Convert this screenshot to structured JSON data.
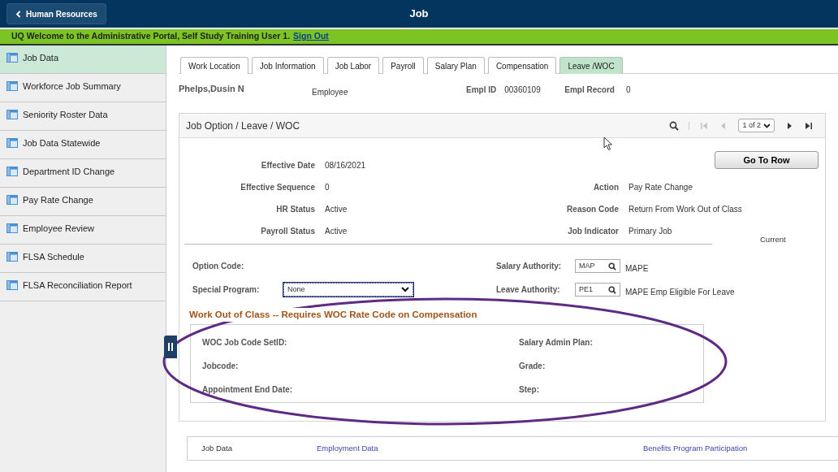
{
  "header": {
    "back_button": "Human Resources",
    "title": "Job"
  },
  "banner": {
    "text": "UQ Welcome to the Administrative Portal, Self Study Training User 1.",
    "link": "Sign Out"
  },
  "sidebar": {
    "items": [
      {
        "label": "Job Data",
        "selected": true
      },
      {
        "label": "Workforce Job Summary",
        "selected": false
      },
      {
        "label": "Seniority Roster Data",
        "selected": false
      },
      {
        "label": "Job Data Statewide",
        "selected": false
      },
      {
        "label": "Department ID Change",
        "selected": false
      },
      {
        "label": "Pay Rate Change",
        "selected": false
      },
      {
        "label": "Employee Review",
        "selected": false
      },
      {
        "label": "FLSA Schedule",
        "selected": false
      },
      {
        "label": "FLSA Reconciliation Report",
        "selected": false
      }
    ]
  },
  "tabs": [
    {
      "label": "Work Location",
      "selected": false
    },
    {
      "label": "Job Information",
      "selected": false
    },
    {
      "label": "Job Labor",
      "selected": false
    },
    {
      "label": "Payroll",
      "selected": false
    },
    {
      "label": "Salary Plan",
      "selected": false
    },
    {
      "label": "Compensation",
      "selected": false
    },
    {
      "label": "Leave /WOC",
      "selected": true
    }
  ],
  "employee": {
    "name": "Phelps,Dusin N",
    "type": "Employee",
    "empl_id_label": "Empl ID",
    "empl_id": "00360109",
    "empl_record_label": "Empl Record",
    "empl_record": "0"
  },
  "panel": {
    "title": "Job Option / Leave / WOC",
    "pager": {
      "page": "1 of 2",
      "buttons": [
        {
          "kind": "search",
          "disabled": false
        },
        {
          "kind": "first",
          "disabled": true
        },
        {
          "kind": "prev",
          "disabled": true
        },
        {
          "kind": "next",
          "disabled": false
        },
        {
          "kind": "last",
          "disabled": false
        }
      ]
    },
    "go_to_row": "Go To Row",
    "rows": [
      {
        "left_label": "Effective Date",
        "left_value": "08/16/2021"
      },
      {
        "left_label": "Effective Sequence",
        "left_value": "0",
        "right_label": "Action",
        "right_value": "Pay Rate Change"
      },
      {
        "left_label": "HR Status",
        "left_value": "Active",
        "right_label": "Reason Code",
        "right_value": "Return From Work Out of Class"
      },
      {
        "left_label": "Payroll Status",
        "left_value": "Active",
        "right_label": "Job Indicator",
        "right_value": "Primary Job"
      }
    ],
    "current": "Current",
    "option_code_label": "Option Code:",
    "special_program": {
      "label": "Special Program:",
      "value": "None"
    },
    "salary_authority": {
      "label": "Salary Authority:",
      "value": "MAP",
      "description": "MAPE"
    },
    "leave_authority": {
      "label": "Leave Authority:",
      "value": "PE1",
      "description": "MAPE Emp Eligible For Leave"
    },
    "woc": {
      "title": "Work Out of Class -- Requires WOC Rate Code on Compensation",
      "left_labels": [
        "WOC Job Code SetID:",
        "Jobcode:",
        "Appointment End Date:"
      ],
      "right_labels": [
        "Salary Admin Plan:",
        "Grade:",
        "Step:"
      ]
    }
  },
  "footer_links": [
    {
      "label": "Job Data",
      "kind": "text"
    },
    {
      "label": "Employment Data",
      "kind": "link"
    },
    {
      "label": "Benefits Program Participation",
      "kind": "link"
    }
  ]
}
